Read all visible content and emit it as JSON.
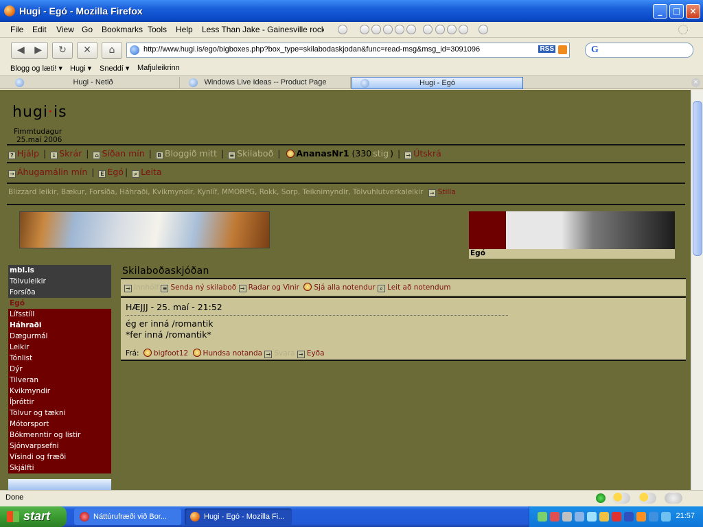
{
  "window": {
    "title": "Hugi - Egó - Mozilla Firefox",
    "minimize": "_",
    "maximize": "□",
    "close": "×"
  },
  "menu": [
    "File",
    "Edit",
    "View",
    "Go",
    "Bookmarks",
    "Tools",
    "Help"
  ],
  "now_playing": "Less Than Jake - Gainesville rock cit",
  "nav": {
    "back": "◀",
    "forward": "▶",
    "reload": "↻",
    "stop": "✕",
    "home": "⌂",
    "url": "http://www.hugi.is/ego/bigboxes.php?box_type=skilabodaskjodan&func=read-msg&msg_id=3091096",
    "rss_label": "RSS",
    "search_value": "",
    "search_engine_label": "G"
  },
  "bookmarks": [
    "Blogg og læti! ▾",
    "Hugi ▾",
    "Sneddí ▾",
    "Mafjuleikrinn"
  ],
  "tabs": [
    {
      "label": "Hugi - Netið"
    },
    {
      "label": "Windows Live Ideas -- Product Page"
    },
    {
      "label": "Hugi - Egó"
    }
  ],
  "page": {
    "logo_main": "hugi",
    "logo_dot": "·",
    "logo_tld": "is",
    "date_line1": "Fimmtudagur",
    "date_line2": "25.maí 2006",
    "topnav": {
      "help": "Hjálp",
      "files": "Skrár",
      "mypage": "Síðan mín",
      "blog": "Bloggið mitt",
      "messages": "Skilaboð",
      "username": "AnanasNr1",
      "points_num": "(330",
      "points_word": "stig",
      "points_close": ")",
      "logout": "Útskrá"
    },
    "secondnav": {
      "interests": "Áhugamálin mín",
      "ego": "Egó",
      "search": "Leita"
    },
    "categories": "Blizzard leikir, Bækur, Forsíða, Háhraði, Kvikmyndir, Kynlíf, MMORPG, Rokk, Sorp, Teiknimyndir, Tölvuhlutverkaleikir",
    "categories_settings": "Stilla",
    "banner_label": "Egó",
    "sidebar_top": [
      "mbl.is",
      "Tölvuleikir",
      "Forsíða"
    ],
    "sidebar_section": "Egó",
    "sidebar_items": [
      "Lífsstíll",
      "Háhraði",
      "Dægurmál",
      "Leikir",
      "Tónlist",
      "Dýr",
      "Tilveran",
      "Kvikmyndir",
      "Íþróttir",
      "Tölvur og tækni",
      "Mótorsport",
      "Bókmenntir og listir",
      "Sjónvarpsefni",
      "Vísindi og fræði",
      "Skjálfti"
    ],
    "title": "Skilaboðaskjóðan",
    "toolbar": {
      "inbox": "Innhólf",
      "new_message": "Senda ný skilaboð",
      "friends": "Radar og Vinir",
      "all_users": "Sjá alla notendur",
      "search_users": "Leit að notendum"
    },
    "message": {
      "subject": "HÆJJJ - 25. maí - 21:52",
      "body_line1": "ég er inná /romantik",
      "body_line2": "*fer inná /romantik*",
      "from_label": "Frá:",
      "from_user": "bigfoot12",
      "ignore": "Hundsa notanda",
      "reply": "Svara",
      "delete": "Eyða"
    }
  },
  "status": "Done",
  "taskbar": {
    "start": "start",
    "task1": "Náttúrufræði við Bor...",
    "task2": "Hugi - Egó - Mozilla Fi...",
    "clock": "21:57"
  },
  "colors": {
    "page_bg": "#6b6b37",
    "accent_red": "#6e0000",
    "box_bg": "#cbc497"
  }
}
